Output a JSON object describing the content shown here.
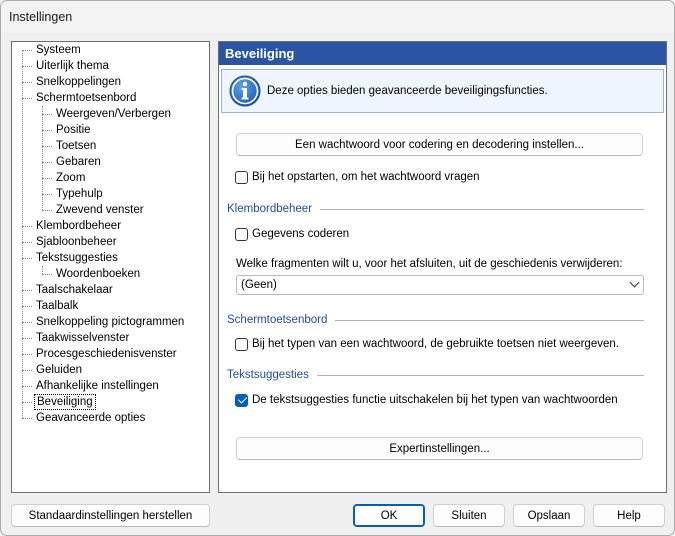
{
  "window": {
    "title": "Instellingen"
  },
  "tree": {
    "items": [
      {
        "label": "Systeem",
        "level": 0
      },
      {
        "label": "Uiterlijk thema",
        "level": 0
      },
      {
        "label": "Snelkoppelingen",
        "level": 0
      },
      {
        "label": "Schermtoetsenbord",
        "level": 0
      },
      {
        "label": "Weergeven/Verbergen",
        "level": 1
      },
      {
        "label": "Positie",
        "level": 1
      },
      {
        "label": "Toetsen",
        "level": 1
      },
      {
        "label": "Gebaren",
        "level": 1
      },
      {
        "label": "Zoom",
        "level": 1
      },
      {
        "label": "Typehulp",
        "level": 1
      },
      {
        "label": "Zwevend venster",
        "level": 1
      },
      {
        "label": "Klembordbeheer",
        "level": 0
      },
      {
        "label": "Sjabloonbeheer",
        "level": 0
      },
      {
        "label": "Tekstsuggesties",
        "level": 0
      },
      {
        "label": "Woordenboeken",
        "level": 1
      },
      {
        "label": "Taalschakelaar",
        "level": 0
      },
      {
        "label": "Taalbalk",
        "level": 0
      },
      {
        "label": "Snelkoppeling pictogrammen",
        "level": 0
      },
      {
        "label": "Taakwisselvenster",
        "level": 0
      },
      {
        "label": "Procesgeschiedenisvenster",
        "level": 0
      },
      {
        "label": "Geluiden",
        "level": 0
      },
      {
        "label": "Afhankelijke instellingen",
        "level": 0
      },
      {
        "label": "Beveiliging",
        "level": 0,
        "selected": true
      },
      {
        "label": "Geavanceerde opties",
        "level": 0
      }
    ]
  },
  "panel": {
    "header": "Beveiliging",
    "info_text": "Deze opties bieden geavanceerde beveiligingsfuncties.",
    "password_button": "Een wachtwoord voor codering en decodering instellen...",
    "ask_password_on_startup": {
      "label": "Bij het opstarten, om het wachtwoord vragen",
      "checked": false
    },
    "clipboard_section": "Klembordbeheer",
    "encrypt_data": {
      "label": "Gegevens coderen",
      "checked": false
    },
    "fragments_label": "Welke fragmenten wilt u, voor het afsluiten, uit de geschiedenis verwijderen:",
    "fragments_select": "(Geen)",
    "keyboard_section": "Schermtoetsenbord",
    "hide_keys": {
      "label": "Bij het typen van een wachtwoord, de gebruikte toetsen niet weergeven.",
      "checked": false
    },
    "suggestions_section": "Tekstsuggesties",
    "disable_suggestions": {
      "label": "De tekstsuggesties functie uitschakelen bij het typen van wachtwoorden",
      "checked": true
    },
    "expert_button": "Expertinstellingen..."
  },
  "footer": {
    "restore_defaults": "Standaardinstellingen herstellen",
    "ok": "OK",
    "close": "Sluiten",
    "save": "Opslaan",
    "help": "Help"
  },
  "colors": {
    "header_bg": "#2a55a5",
    "section_title": "#1e4e9a",
    "accent": "#005fb8"
  }
}
